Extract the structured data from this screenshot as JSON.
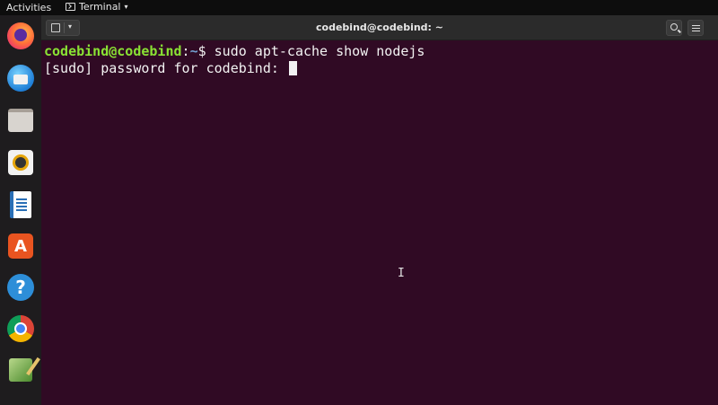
{
  "topbar": {
    "activities_label": "Activities",
    "app_menu_label": "Terminal",
    "app_menu_caret": "▾"
  },
  "dock": {
    "items": [
      {
        "name": "Firefox",
        "icon": "firefox-icon",
        "running": true
      },
      {
        "name": "Thunderbird Mail",
        "icon": "thunderbird-icon",
        "running": false
      },
      {
        "name": "Files",
        "icon": "files-icon",
        "running": false
      },
      {
        "name": "Rhythmbox",
        "icon": "rhythmbox-icon",
        "running": false
      },
      {
        "name": "LibreOffice Writer",
        "icon": "writer-icon",
        "running": false
      },
      {
        "name": "Ubuntu Software",
        "icon": "software-icon",
        "store_glyph": "A",
        "running": false
      },
      {
        "name": "Help",
        "icon": "help-icon",
        "help_glyph": "?",
        "running": false
      },
      {
        "name": "Google Chrome",
        "icon": "chrome-icon",
        "running": false
      },
      {
        "name": "Text Editor",
        "icon": "text-editor-icon",
        "running": false
      }
    ]
  },
  "window": {
    "title": "codebind@codebind: ~",
    "newtab_caret": "▾"
  },
  "terminal": {
    "prompt_user": "codebind@codebind",
    "prompt_sep": ":",
    "prompt_path": "~",
    "prompt_symbol": "$ ",
    "command": "sudo apt-cache show nodejs",
    "sudo_prompt": "[sudo] password for codebind: "
  },
  "colors": {
    "terminal_bg": "#300a24",
    "prompt_user": "#8ae234",
    "prompt_path": "#729fcf",
    "accent": "#e95420"
  }
}
